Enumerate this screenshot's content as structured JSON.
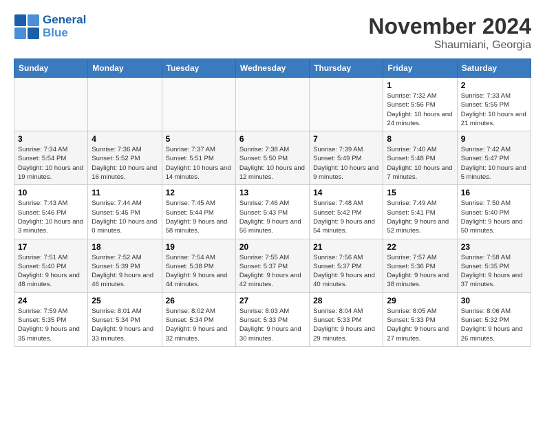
{
  "logo": {
    "line1": "General",
    "line2": "Blue"
  },
  "title": "November 2024",
  "location": "Shaumiani, Georgia",
  "weekdays": [
    "Sunday",
    "Monday",
    "Tuesday",
    "Wednesday",
    "Thursday",
    "Friday",
    "Saturday"
  ],
  "weeks": [
    [
      {
        "day": "",
        "info": ""
      },
      {
        "day": "",
        "info": ""
      },
      {
        "day": "",
        "info": ""
      },
      {
        "day": "",
        "info": ""
      },
      {
        "day": "",
        "info": ""
      },
      {
        "day": "1",
        "info": "Sunrise: 7:32 AM\nSunset: 5:56 PM\nDaylight: 10 hours and 24 minutes."
      },
      {
        "day": "2",
        "info": "Sunrise: 7:33 AM\nSunset: 5:55 PM\nDaylight: 10 hours and 21 minutes."
      }
    ],
    [
      {
        "day": "3",
        "info": "Sunrise: 7:34 AM\nSunset: 5:54 PM\nDaylight: 10 hours and 19 minutes."
      },
      {
        "day": "4",
        "info": "Sunrise: 7:36 AM\nSunset: 5:52 PM\nDaylight: 10 hours and 16 minutes."
      },
      {
        "day": "5",
        "info": "Sunrise: 7:37 AM\nSunset: 5:51 PM\nDaylight: 10 hours and 14 minutes."
      },
      {
        "day": "6",
        "info": "Sunrise: 7:38 AM\nSunset: 5:50 PM\nDaylight: 10 hours and 12 minutes."
      },
      {
        "day": "7",
        "info": "Sunrise: 7:39 AM\nSunset: 5:49 PM\nDaylight: 10 hours and 9 minutes."
      },
      {
        "day": "8",
        "info": "Sunrise: 7:40 AM\nSunset: 5:48 PM\nDaylight: 10 hours and 7 minutes."
      },
      {
        "day": "9",
        "info": "Sunrise: 7:42 AM\nSunset: 5:47 PM\nDaylight: 10 hours and 5 minutes."
      }
    ],
    [
      {
        "day": "10",
        "info": "Sunrise: 7:43 AM\nSunset: 5:46 PM\nDaylight: 10 hours and 3 minutes."
      },
      {
        "day": "11",
        "info": "Sunrise: 7:44 AM\nSunset: 5:45 PM\nDaylight: 10 hours and 0 minutes."
      },
      {
        "day": "12",
        "info": "Sunrise: 7:45 AM\nSunset: 5:44 PM\nDaylight: 9 hours and 58 minutes."
      },
      {
        "day": "13",
        "info": "Sunrise: 7:46 AM\nSunset: 5:43 PM\nDaylight: 9 hours and 56 minutes."
      },
      {
        "day": "14",
        "info": "Sunrise: 7:48 AM\nSunset: 5:42 PM\nDaylight: 9 hours and 54 minutes."
      },
      {
        "day": "15",
        "info": "Sunrise: 7:49 AM\nSunset: 5:41 PM\nDaylight: 9 hours and 52 minutes."
      },
      {
        "day": "16",
        "info": "Sunrise: 7:50 AM\nSunset: 5:40 PM\nDaylight: 9 hours and 50 minutes."
      }
    ],
    [
      {
        "day": "17",
        "info": "Sunrise: 7:51 AM\nSunset: 5:40 PM\nDaylight: 9 hours and 48 minutes."
      },
      {
        "day": "18",
        "info": "Sunrise: 7:52 AM\nSunset: 5:39 PM\nDaylight: 9 hours and 46 minutes."
      },
      {
        "day": "19",
        "info": "Sunrise: 7:54 AM\nSunset: 5:38 PM\nDaylight: 9 hours and 44 minutes."
      },
      {
        "day": "20",
        "info": "Sunrise: 7:55 AM\nSunset: 5:37 PM\nDaylight: 9 hours and 42 minutes."
      },
      {
        "day": "21",
        "info": "Sunrise: 7:56 AM\nSunset: 5:37 PM\nDaylight: 9 hours and 40 minutes."
      },
      {
        "day": "22",
        "info": "Sunrise: 7:57 AM\nSunset: 5:36 PM\nDaylight: 9 hours and 38 minutes."
      },
      {
        "day": "23",
        "info": "Sunrise: 7:58 AM\nSunset: 5:35 PM\nDaylight: 9 hours and 37 minutes."
      }
    ],
    [
      {
        "day": "24",
        "info": "Sunrise: 7:59 AM\nSunset: 5:35 PM\nDaylight: 9 hours and 35 minutes."
      },
      {
        "day": "25",
        "info": "Sunrise: 8:01 AM\nSunset: 5:34 PM\nDaylight: 9 hours and 33 minutes."
      },
      {
        "day": "26",
        "info": "Sunrise: 8:02 AM\nSunset: 5:34 PM\nDaylight: 9 hours and 32 minutes."
      },
      {
        "day": "27",
        "info": "Sunrise: 8:03 AM\nSunset: 5:33 PM\nDaylight: 9 hours and 30 minutes."
      },
      {
        "day": "28",
        "info": "Sunrise: 8:04 AM\nSunset: 5:33 PM\nDaylight: 9 hours and 29 minutes."
      },
      {
        "day": "29",
        "info": "Sunrise: 8:05 AM\nSunset: 5:33 PM\nDaylight: 9 hours and 27 minutes."
      },
      {
        "day": "30",
        "info": "Sunrise: 8:06 AM\nSunset: 5:32 PM\nDaylight: 9 hours and 26 minutes."
      }
    ]
  ]
}
